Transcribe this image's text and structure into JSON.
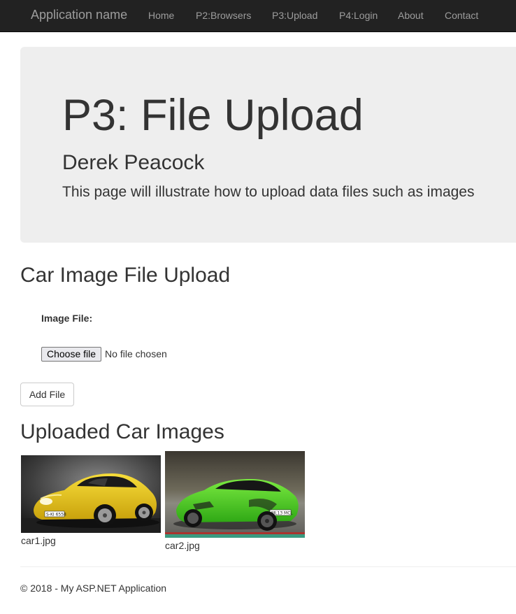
{
  "navbar": {
    "brand": "Application name",
    "links": [
      "Home",
      "P2:Browsers",
      "P3:Upload",
      "P4:Login",
      "About",
      "Contact"
    ]
  },
  "jumbotron": {
    "title": "P3: File Upload",
    "subtitle": "Derek Peacock",
    "lead": "This page will illustrate how to upload data files such as images"
  },
  "upload": {
    "heading": "Car Image File Upload",
    "field_label": "Image File:",
    "choose_label": "Choose file",
    "file_status": "No file chosen",
    "add_button": "Add File"
  },
  "gallery": {
    "heading": "Uploaded Car Images",
    "images": [
      {
        "caption": "car1.jpg",
        "plate": "S-KI 6558",
        "color": "#e8c51a"
      },
      {
        "caption": "car2.jpg",
        "plate": "ML13 MCL",
        "color": "#4fd12a"
      }
    ]
  },
  "footer": {
    "text": "© 2018 - My ASP.NET Application"
  }
}
